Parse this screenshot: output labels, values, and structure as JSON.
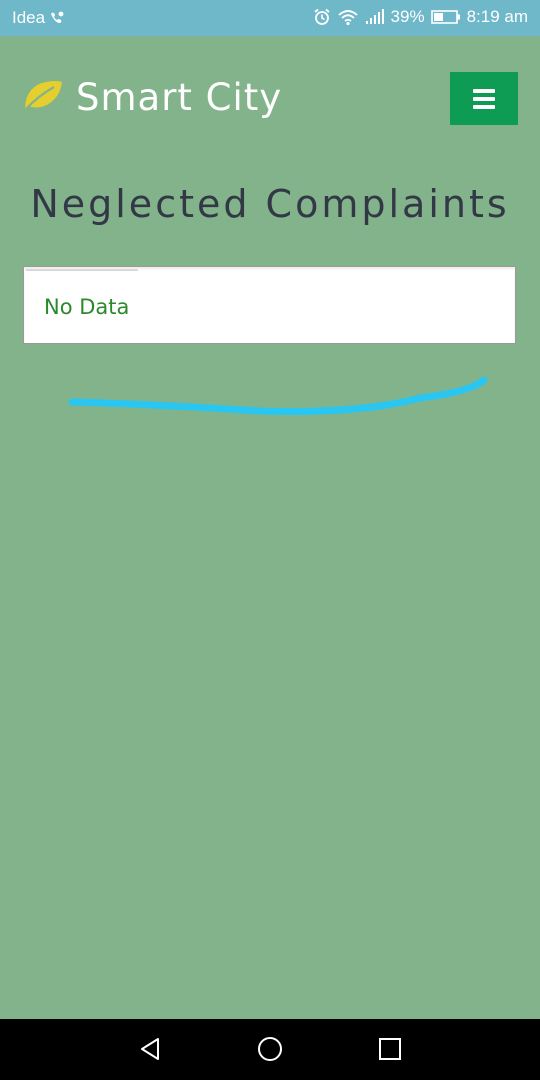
{
  "status_bar": {
    "carrier": "Idea",
    "battery_percent": "39%",
    "time": "8:19 am",
    "icons": [
      "call-icon",
      "alarm-icon",
      "wifi-icon",
      "signal-icon",
      "battery-icon"
    ]
  },
  "header": {
    "app_title": "Smart City",
    "logo_icon": "leaf-icon",
    "menu_icon": "hamburger-icon"
  },
  "main": {
    "page_title": "Neglected Complaints",
    "empty_message": "No Data"
  },
  "nav_bar": {
    "icons": [
      "back-icon",
      "home-icon",
      "recents-icon"
    ]
  },
  "colors": {
    "status_bar": "#6eb8c9",
    "background": "#83b38b",
    "menu_button": "#0e9b54",
    "title_text": "#333846",
    "empty_text": "#2a8a2a",
    "annotation_stroke": "#29c6f2",
    "leaf": "#e5cf2e"
  }
}
